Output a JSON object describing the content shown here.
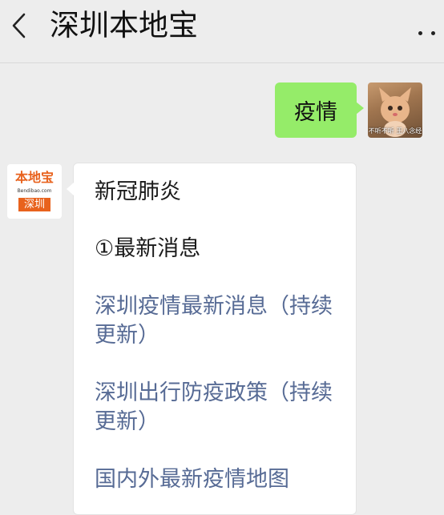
{
  "header": {
    "title": "深圳本地宝",
    "back_icon": "chevron-left-icon",
    "more_icon": "more-dots-icon"
  },
  "messages": {
    "outgoing": {
      "text": "疫情",
      "bubble_color": "#95ec69",
      "avatar_caption": "不听不听 王八念经"
    },
    "incoming": {
      "avatar": {
        "name": "本地宝",
        "url": "Bendibao.com",
        "city": "深圳",
        "brand_color": "#e8621d"
      },
      "heading": "新冠肺炎",
      "section": "①最新消息",
      "links": [
        "深圳疫情最新消息（持续更新）",
        "深圳出行防疫政策（持续更新）",
        "国内外最新疫情地图"
      ],
      "link_color": "#576b95"
    }
  }
}
